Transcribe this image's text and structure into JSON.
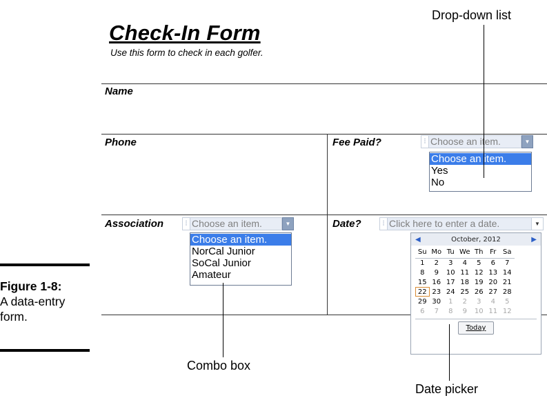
{
  "form": {
    "title": "Check-In Form",
    "subtitle": "Use this form to check in each golfer."
  },
  "fields": {
    "name_label": "Name",
    "phone_label": "Phone",
    "fee_label": "Fee Paid?",
    "association_label": "Association",
    "date_label": "Date?"
  },
  "fee_dropdown": {
    "value": "Choose an item.",
    "options": [
      "Choose an item.",
      "Yes",
      "No"
    ],
    "selected_index": 0
  },
  "association_combo": {
    "value": "Choose an item.",
    "options": [
      "Choose an item.",
      "NorCal Junior",
      "SoCal Junior",
      "Amateur"
    ],
    "selected_index": 0
  },
  "date_picker": {
    "placeholder": "Click here to enter a date.",
    "month_label": "October, 2012",
    "weekdays": [
      "Su",
      "Mo",
      "Tu",
      "We",
      "Th",
      "Fr",
      "Sa"
    ],
    "weeks": [
      [
        {
          "d": "1"
        },
        {
          "d": "2"
        },
        {
          "d": "3"
        },
        {
          "d": "4"
        },
        {
          "d": "5"
        },
        {
          "d": "6"
        },
        {
          "d": "7"
        }
      ],
      [
        {
          "d": "8"
        },
        {
          "d": "9"
        },
        {
          "d": "10"
        },
        {
          "d": "11"
        },
        {
          "d": "12"
        },
        {
          "d": "13"
        },
        {
          "d": "14"
        }
      ],
      [
        {
          "d": "15"
        },
        {
          "d": "16"
        },
        {
          "d": "17"
        },
        {
          "d": "18"
        },
        {
          "d": "19"
        },
        {
          "d": "20"
        },
        {
          "d": "21"
        }
      ],
      [
        {
          "d": "22",
          "today": true
        },
        {
          "d": "23"
        },
        {
          "d": "24"
        },
        {
          "d": "25"
        },
        {
          "d": "26"
        },
        {
          "d": "27"
        },
        {
          "d": "28"
        }
      ],
      [
        {
          "d": "29"
        },
        {
          "d": "30"
        },
        {
          "d": "1",
          "other": true
        },
        {
          "d": "2",
          "other": true
        },
        {
          "d": "3",
          "other": true
        },
        {
          "d": "4",
          "other": true
        },
        {
          "d": "5",
          "other": true
        }
      ],
      [
        {
          "d": "6",
          "other": true
        },
        {
          "d": "7",
          "other": true
        },
        {
          "d": "8",
          "other": true
        },
        {
          "d": "9",
          "other": true
        },
        {
          "d": "10",
          "other": true
        },
        {
          "d": "11",
          "other": true
        },
        {
          "d": "12",
          "other": true
        }
      ]
    ],
    "today_button": "Today"
  },
  "callouts": {
    "dropdown": "Drop-down list",
    "combo": "Combo box",
    "datepicker": "Date picker"
  },
  "figure": {
    "number": "Figure 1-8:",
    "caption_line1": "A data-entry",
    "caption_line2": "form."
  }
}
